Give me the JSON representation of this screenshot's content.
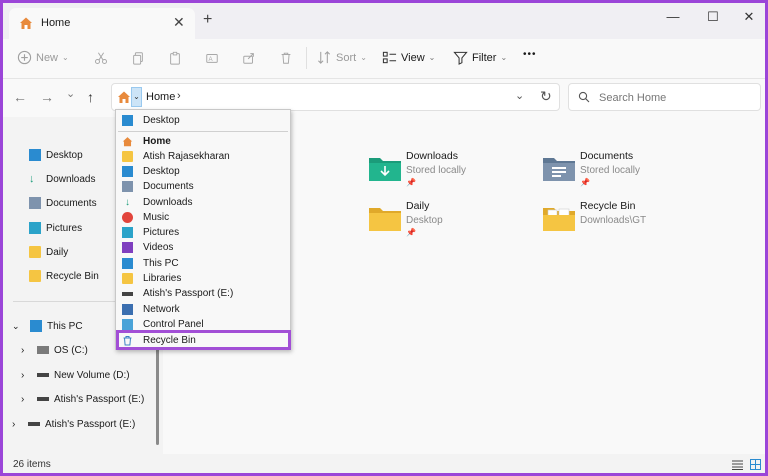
{
  "window": {
    "tab_title": "Home",
    "tab_close": "✕",
    "new_tab": "+",
    "minimize": "—",
    "maximize": "☐",
    "close": "✕"
  },
  "toolbar": {
    "new_label": "New",
    "sort_label": "Sort",
    "view_label": "View",
    "filter_label": "Filter",
    "more_label": "•••"
  },
  "address": {
    "crumb": "Home",
    "crumb_sep": "›",
    "dropdown_chev": "⌄",
    "refresh": "↻",
    "expand_chev": "⌄"
  },
  "search": {
    "placeholder": "Search Home"
  },
  "nav": {
    "back": "←",
    "forward": "→",
    "recent": "⌄",
    "up": "↑"
  },
  "sidebar": {
    "quick": [
      {
        "label": "Desktop",
        "icon": "desktop-icon"
      },
      {
        "label": "Downloads",
        "icon": "download-icon"
      },
      {
        "label": "Documents",
        "icon": "documents-icon"
      },
      {
        "label": "Pictures",
        "icon": "pictures-icon"
      },
      {
        "label": "Daily",
        "icon": "folder-icon"
      },
      {
        "label": "Recycle Bin",
        "icon": "folder-icon"
      }
    ],
    "tree": [
      {
        "label": "This PC",
        "chevron": "⌄"
      },
      {
        "label": "OS (C:)",
        "chevron": "›"
      },
      {
        "label": "New Volume (D:)",
        "chevron": "›"
      },
      {
        "label": "Atish's Passport  (E:)",
        "chevron": "›"
      },
      {
        "label": "Atish's Passport  (E:)",
        "chevron": "›"
      }
    ]
  },
  "content": {
    "items": [
      {
        "name": "Downloads",
        "sub": "Stored locally",
        "pin": "📌",
        "color": "#1b9c7a"
      },
      {
        "name": "Documents",
        "sub": "Stored locally",
        "pin": "📌",
        "color": "#6f89a8"
      },
      {
        "name": "Daily",
        "sub": "Desktop",
        "pin": "📌",
        "color": "#f5c542"
      },
      {
        "name": "Recycle Bin",
        "sub": "Downloads\\GT",
        "pin": "",
        "color": "#f5c542"
      }
    ]
  },
  "dropdown": {
    "items": [
      {
        "label": "Desktop",
        "icon": "desktop-icon",
        "bold": false
      },
      {
        "label": "Home",
        "icon": "home-icon",
        "bold": true
      },
      {
        "label": "Atish Rajasekharan",
        "icon": "folder-icon",
        "bold": false
      },
      {
        "label": "Desktop",
        "icon": "desktop-icon",
        "bold": false
      },
      {
        "label": "Documents",
        "icon": "documents-icon",
        "bold": false
      },
      {
        "label": "Downloads",
        "icon": "download-icon",
        "bold": false
      },
      {
        "label": "Music",
        "icon": "music-icon",
        "bold": false
      },
      {
        "label": "Pictures",
        "icon": "pictures-icon",
        "bold": false
      },
      {
        "label": "Videos",
        "icon": "videos-icon",
        "bold": false
      },
      {
        "label": "This PC",
        "icon": "pc-icon",
        "bold": false
      },
      {
        "label": "Libraries",
        "icon": "folder-icon",
        "bold": false
      },
      {
        "label": "Atish's Passport  (E:)",
        "icon": "drive-icon",
        "bold": false
      },
      {
        "label": "Network",
        "icon": "network-icon",
        "bold": false
      },
      {
        "label": "Control Panel",
        "icon": "control-panel-icon",
        "bold": false
      },
      {
        "label": "Recycle Bin",
        "icon": "recycle-bin-icon",
        "bold": false
      }
    ]
  },
  "status": {
    "count": "26 items"
  },
  "colors": {
    "highlight": "#a24fd6",
    "accent": "#2a8bd0"
  }
}
